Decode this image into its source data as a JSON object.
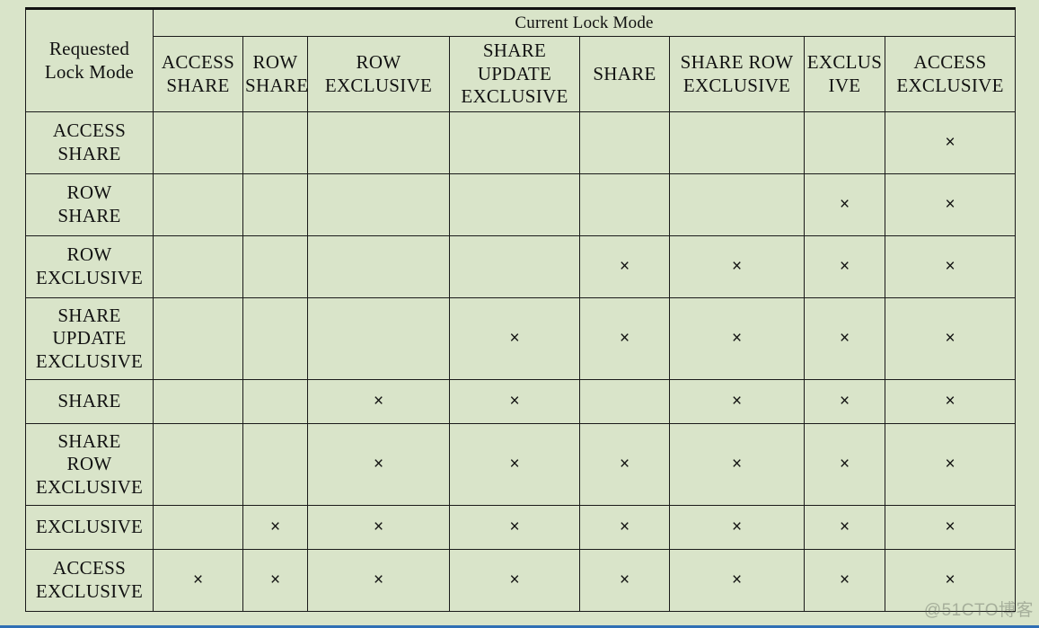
{
  "table": {
    "stub_label_lines": [
      "Requested",
      "Lock Mode"
    ],
    "group_header": "Current Lock Mode",
    "columns": [
      {
        "id": "access-share",
        "lines": [
          "ACCESS",
          "SHARE"
        ]
      },
      {
        "id": "row-share",
        "lines": [
          "ROW",
          "SHARE"
        ]
      },
      {
        "id": "row-exclusive",
        "lines": [
          "ROW",
          "EXCLUSIVE"
        ]
      },
      {
        "id": "share-update-exclusive",
        "lines": [
          "SHARE",
          "UPDATE",
          "EXCLUSIVE"
        ]
      },
      {
        "id": "share",
        "lines": [
          "SHARE"
        ]
      },
      {
        "id": "share-row-exclusive",
        "lines": [
          "SHARE ROW",
          "EXCLUSIVE"
        ]
      },
      {
        "id": "exclusive",
        "lines": [
          "EXCLUS",
          "IVE"
        ]
      },
      {
        "id": "access-exclusive",
        "lines": [
          "ACCESS",
          "EXCLUSIVE"
        ]
      }
    ],
    "rows": [
      {
        "id": "access-share",
        "lines": [
          "ACCESS",
          "SHARE"
        ],
        "marks": [
          false,
          false,
          false,
          false,
          false,
          false,
          false,
          true
        ]
      },
      {
        "id": "row-share",
        "lines": [
          "ROW",
          "SHARE"
        ],
        "marks": [
          false,
          false,
          false,
          false,
          false,
          false,
          true,
          true
        ]
      },
      {
        "id": "row-exclusive",
        "lines": [
          "ROW",
          "EXCLUSIVE"
        ],
        "marks": [
          false,
          false,
          false,
          false,
          true,
          true,
          true,
          true
        ]
      },
      {
        "id": "share-update-exclusive",
        "lines": [
          "SHARE",
          "UPDATE",
          "EXCLUSIVE"
        ],
        "marks": [
          false,
          false,
          false,
          true,
          true,
          true,
          true,
          true
        ]
      },
      {
        "id": "share",
        "lines": [
          "SHARE"
        ],
        "marks": [
          false,
          false,
          true,
          true,
          false,
          true,
          true,
          true
        ]
      },
      {
        "id": "share-row-exclusive",
        "lines": [
          "SHARE",
          "ROW",
          "EXCLUSIVE"
        ],
        "marks": [
          false,
          false,
          true,
          true,
          true,
          true,
          true,
          true
        ]
      },
      {
        "id": "exclusive",
        "lines": [
          "EXCLUSIVE"
        ],
        "marks": [
          false,
          true,
          true,
          true,
          true,
          true,
          true,
          true
        ]
      },
      {
        "id": "access-exclusive",
        "lines": [
          "ACCESS",
          "EXCLUSIVE"
        ],
        "marks": [
          true,
          true,
          true,
          true,
          true,
          true,
          true,
          true
        ]
      }
    ],
    "conflict_mark": "×",
    "colors": {
      "cell_background": "#d9e4c9",
      "border": "#1a1a1a",
      "text": "#111111",
      "bottom_strip": "#2f6fb5"
    }
  },
  "watermark": {
    "text": "@51CTO博客"
  }
}
